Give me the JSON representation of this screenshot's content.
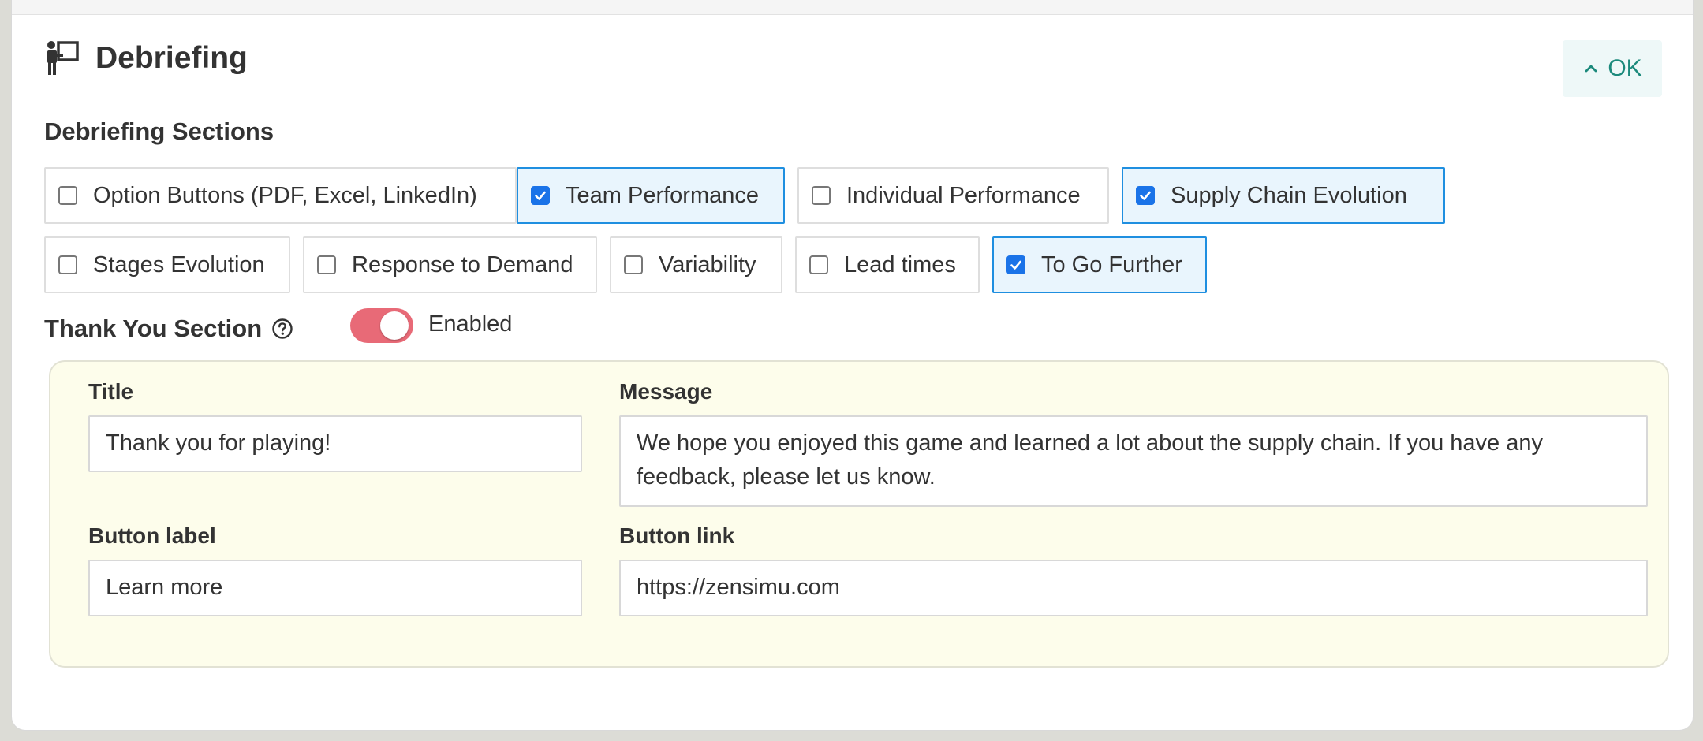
{
  "header": {
    "title": "Debriefing",
    "icon": "presenter-icon",
    "ok_label": "OK"
  },
  "sections": {
    "label": "Debriefing Sections",
    "items": [
      {
        "label": "Option Buttons (PDF, Excel, LinkedIn)",
        "checked": false
      },
      {
        "label": "Team Performance",
        "checked": true
      },
      {
        "label": "Individual Performance",
        "checked": false
      },
      {
        "label": "Supply Chain Evolution",
        "checked": true
      },
      {
        "label": "Stages Evolution",
        "checked": false
      },
      {
        "label": "Response to Demand",
        "checked": false
      },
      {
        "label": "Variability",
        "checked": false
      },
      {
        "label": "Lead times",
        "checked": false
      },
      {
        "label": "To Go Further",
        "checked": true
      }
    ]
  },
  "thank_you": {
    "label": "Thank You Section",
    "toggle_label": "Enabled",
    "enabled": true,
    "title_label": "Title",
    "title_value": "Thank you for playing!",
    "message_label": "Message",
    "message_value": "We hope you enjoyed this game and learned a lot about the supply chain. If you have any feedback, please let us know.",
    "button_label_label": "Button label",
    "button_label_value": "Learn more",
    "button_link_label": "Button link",
    "button_link_value": "https://zensimu.com"
  },
  "colors": {
    "accent": "#1a73e8",
    "toggle_on": "#e86a77",
    "ok_text": "#1c8a7c",
    "thank_you_bg": "#fdfdeb"
  }
}
